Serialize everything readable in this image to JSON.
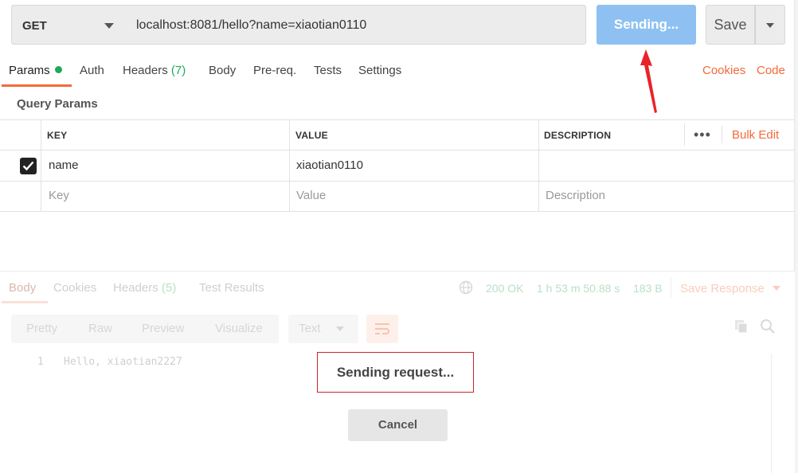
{
  "request": {
    "method": "GET",
    "url": "localhost:8081/hello?name=xiaotian0110",
    "send_label": "Sending...",
    "save_label": "Save"
  },
  "request_tabs": {
    "params": "Params",
    "auth": "Auth",
    "headers": "Headers",
    "headers_count": "(7)",
    "body": "Body",
    "prereq": "Pre-req.",
    "tests": "Tests",
    "settings": "Settings",
    "cookies": "Cookies",
    "code": "Code"
  },
  "query_params": {
    "title": "Query Params",
    "columns": {
      "key": "KEY",
      "value": "VALUE",
      "description": "DESCRIPTION"
    },
    "more": "•••",
    "bulk_edit": "Bulk Edit",
    "rows": [
      {
        "checked": true,
        "key": "name",
        "value": "xiaotian0110",
        "description": ""
      }
    ],
    "placeholders": {
      "key": "Key",
      "value": "Value",
      "description": "Description"
    }
  },
  "response": {
    "tabs": {
      "body": "Body",
      "cookies": "Cookies",
      "headers": "Headers",
      "headers_count": "(5)",
      "tests": "Test Results"
    },
    "status": "200 OK",
    "time": "1 h 53 m 50.88 s",
    "size": "183 B",
    "save_response": "Save Response",
    "views": {
      "pretty": "Pretty",
      "raw": "Raw",
      "preview": "Preview",
      "visualize": "Visualize"
    },
    "format": "Text",
    "line_no": "1",
    "body_text": "Hello, xiaotian2227"
  },
  "overlay": {
    "message": "Sending request...",
    "cancel": "Cancel"
  },
  "colors": {
    "accent_orange": "#f26b3a",
    "send_blue": "#8ec1f2",
    "success_green": "#1fa85a",
    "annotation_red": "#e8232a"
  }
}
